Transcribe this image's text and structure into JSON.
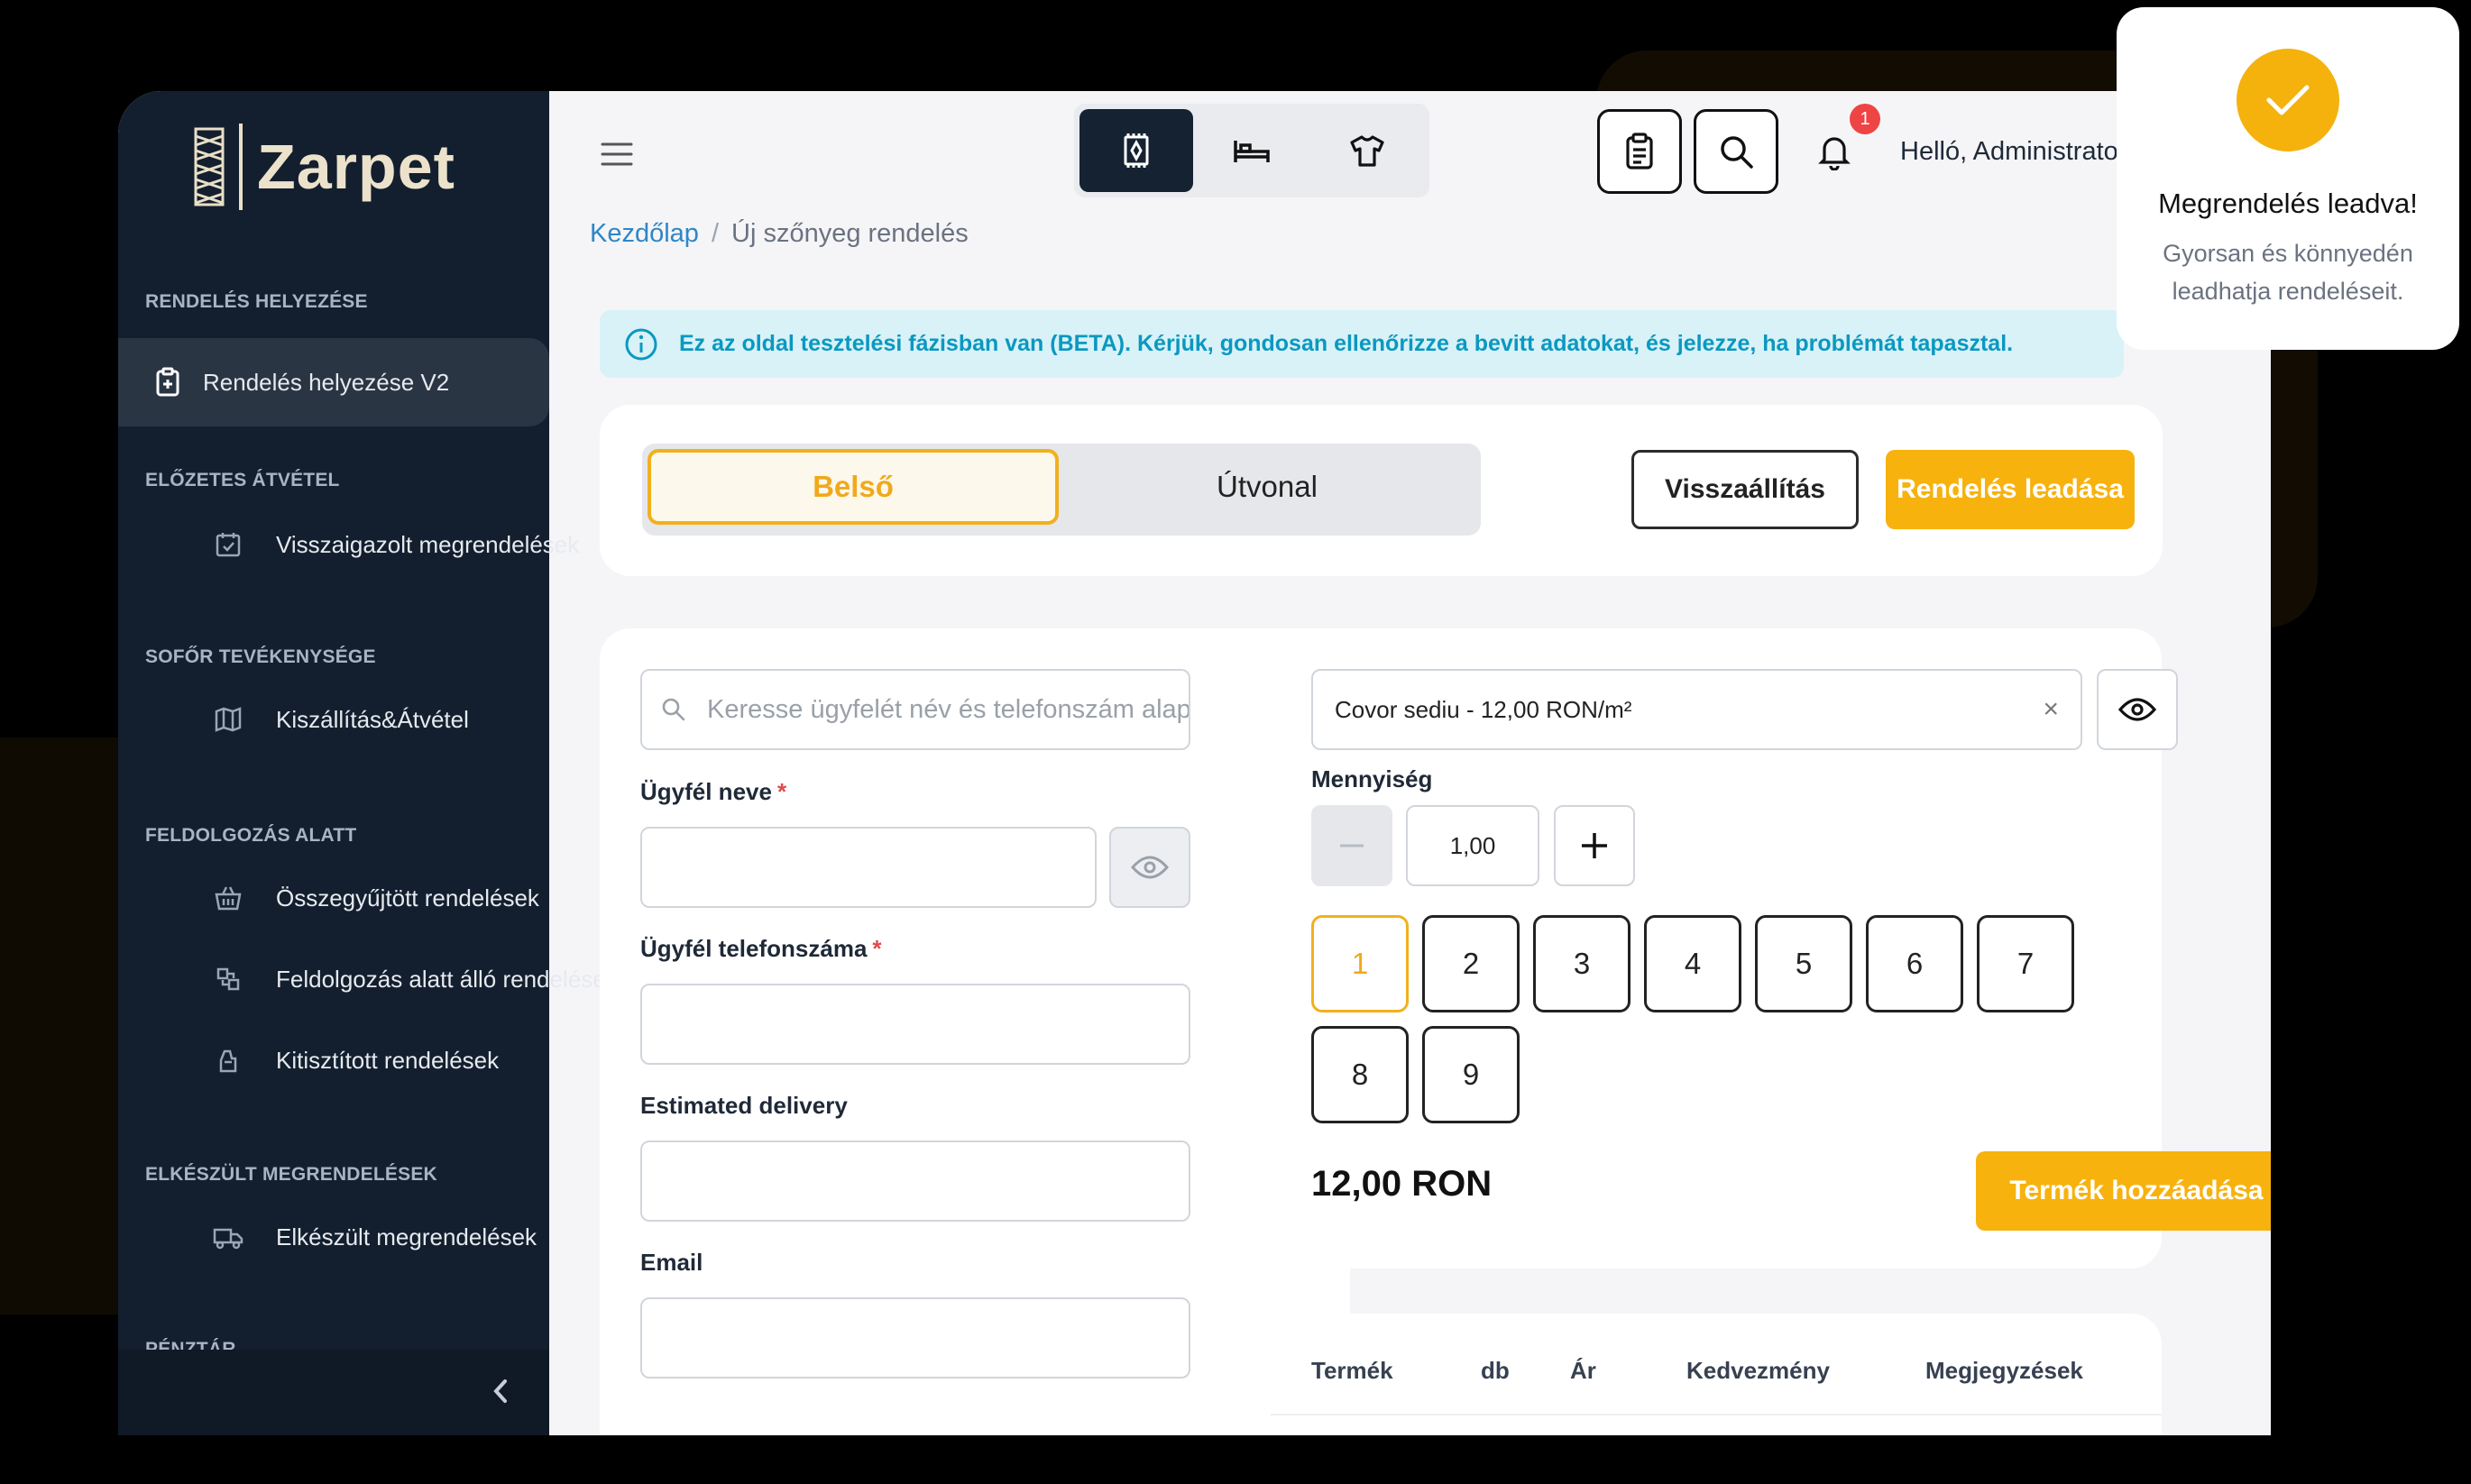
{
  "app": {
    "brand": "Zarpet"
  },
  "header": {
    "greeting": "Helló, Administrator",
    "notification_count": "1",
    "segments": [
      {
        "icon": "rug-icon",
        "active": true
      },
      {
        "icon": "bed-icon",
        "active": false
      },
      {
        "icon": "shirt-icon",
        "active": false
      }
    ]
  },
  "sidebar": {
    "sections": [
      {
        "title": "RENDELÉS HELYEZÉSE",
        "items": [
          {
            "label": "Rendelés helyezése V2",
            "icon": "clipboard-plus-icon",
            "active": true
          }
        ]
      },
      {
        "title": "ELŐZETES ÁTVÉTEL",
        "items": [
          {
            "label": "Visszaigazolt megrendelések",
            "icon": "calendar-check-icon"
          }
        ]
      },
      {
        "title": "SOFŐR TEVÉKENYSÉGE",
        "items": [
          {
            "label": "Kiszállítás&Átvétel",
            "icon": "map-icon"
          }
        ]
      },
      {
        "title": "FELDOLGOZÁS ALATT",
        "items": [
          {
            "label": "Összegyűjtött rendelések",
            "icon": "basket-icon"
          },
          {
            "label": "Feldolgozás alatt álló rendelések",
            "icon": "process-icon"
          },
          {
            "label": "Kitisztított rendelések",
            "icon": "washing-icon"
          }
        ]
      },
      {
        "title": "ELKÉSZÜLT MEGRENDELÉSEK",
        "items": [
          {
            "label": "Elkészült megrendelések",
            "icon": "truck-icon"
          }
        ]
      },
      {
        "title": "PÉNZTÁR",
        "items": []
      }
    ]
  },
  "breadcrumb": {
    "home": "Kezdőlap",
    "separator": "/",
    "current": "Új szőnyeg rendelés"
  },
  "alert": {
    "text": "Ez az oldal tesztelési fázisban van (BETA). Kérjük, gondosan ellenőrizze a bevitt adatokat, és jelezze, ha problémát tapasztal."
  },
  "order_type": {
    "tabs": [
      "Belső",
      "Útvonal"
    ],
    "active": "Belső",
    "reset_label": "Visszaállítás",
    "submit_label": "Rendelés leadása"
  },
  "customer": {
    "search_placeholder": "Keresse ügyfelét név és telefonszám alapján",
    "name_label": "Ügyfél neve",
    "phone_label": "Ügyfél telefonszáma",
    "delivery_label": "Estimated delivery",
    "email_label": "Email",
    "required_mark": "*"
  },
  "product": {
    "selected": "Covor sediu  - 12,00 RON/m²",
    "clear_symbol": "×",
    "quantity_label": "Mennyiség",
    "quantity_value": "1,00",
    "quick_numbers": [
      "1",
      "2",
      "3",
      "4",
      "5",
      "6",
      "7",
      "8",
      "9"
    ],
    "selected_number": "1",
    "price": "12,00 RON",
    "add_label": "Termék hozzáadása"
  },
  "table": {
    "columns": [
      "Termék",
      "db",
      "Ár",
      "Kedvezmény",
      "Megjegyzések"
    ]
  },
  "toast": {
    "title": "Megrendelés leadva!",
    "message": "Gyorsan és könnyedén leadhatja rendeléseit."
  },
  "colors": {
    "accent": "#f7b20e",
    "sidebar": "#131f2e",
    "link": "#2f86c8",
    "info": "#0b98c0"
  }
}
